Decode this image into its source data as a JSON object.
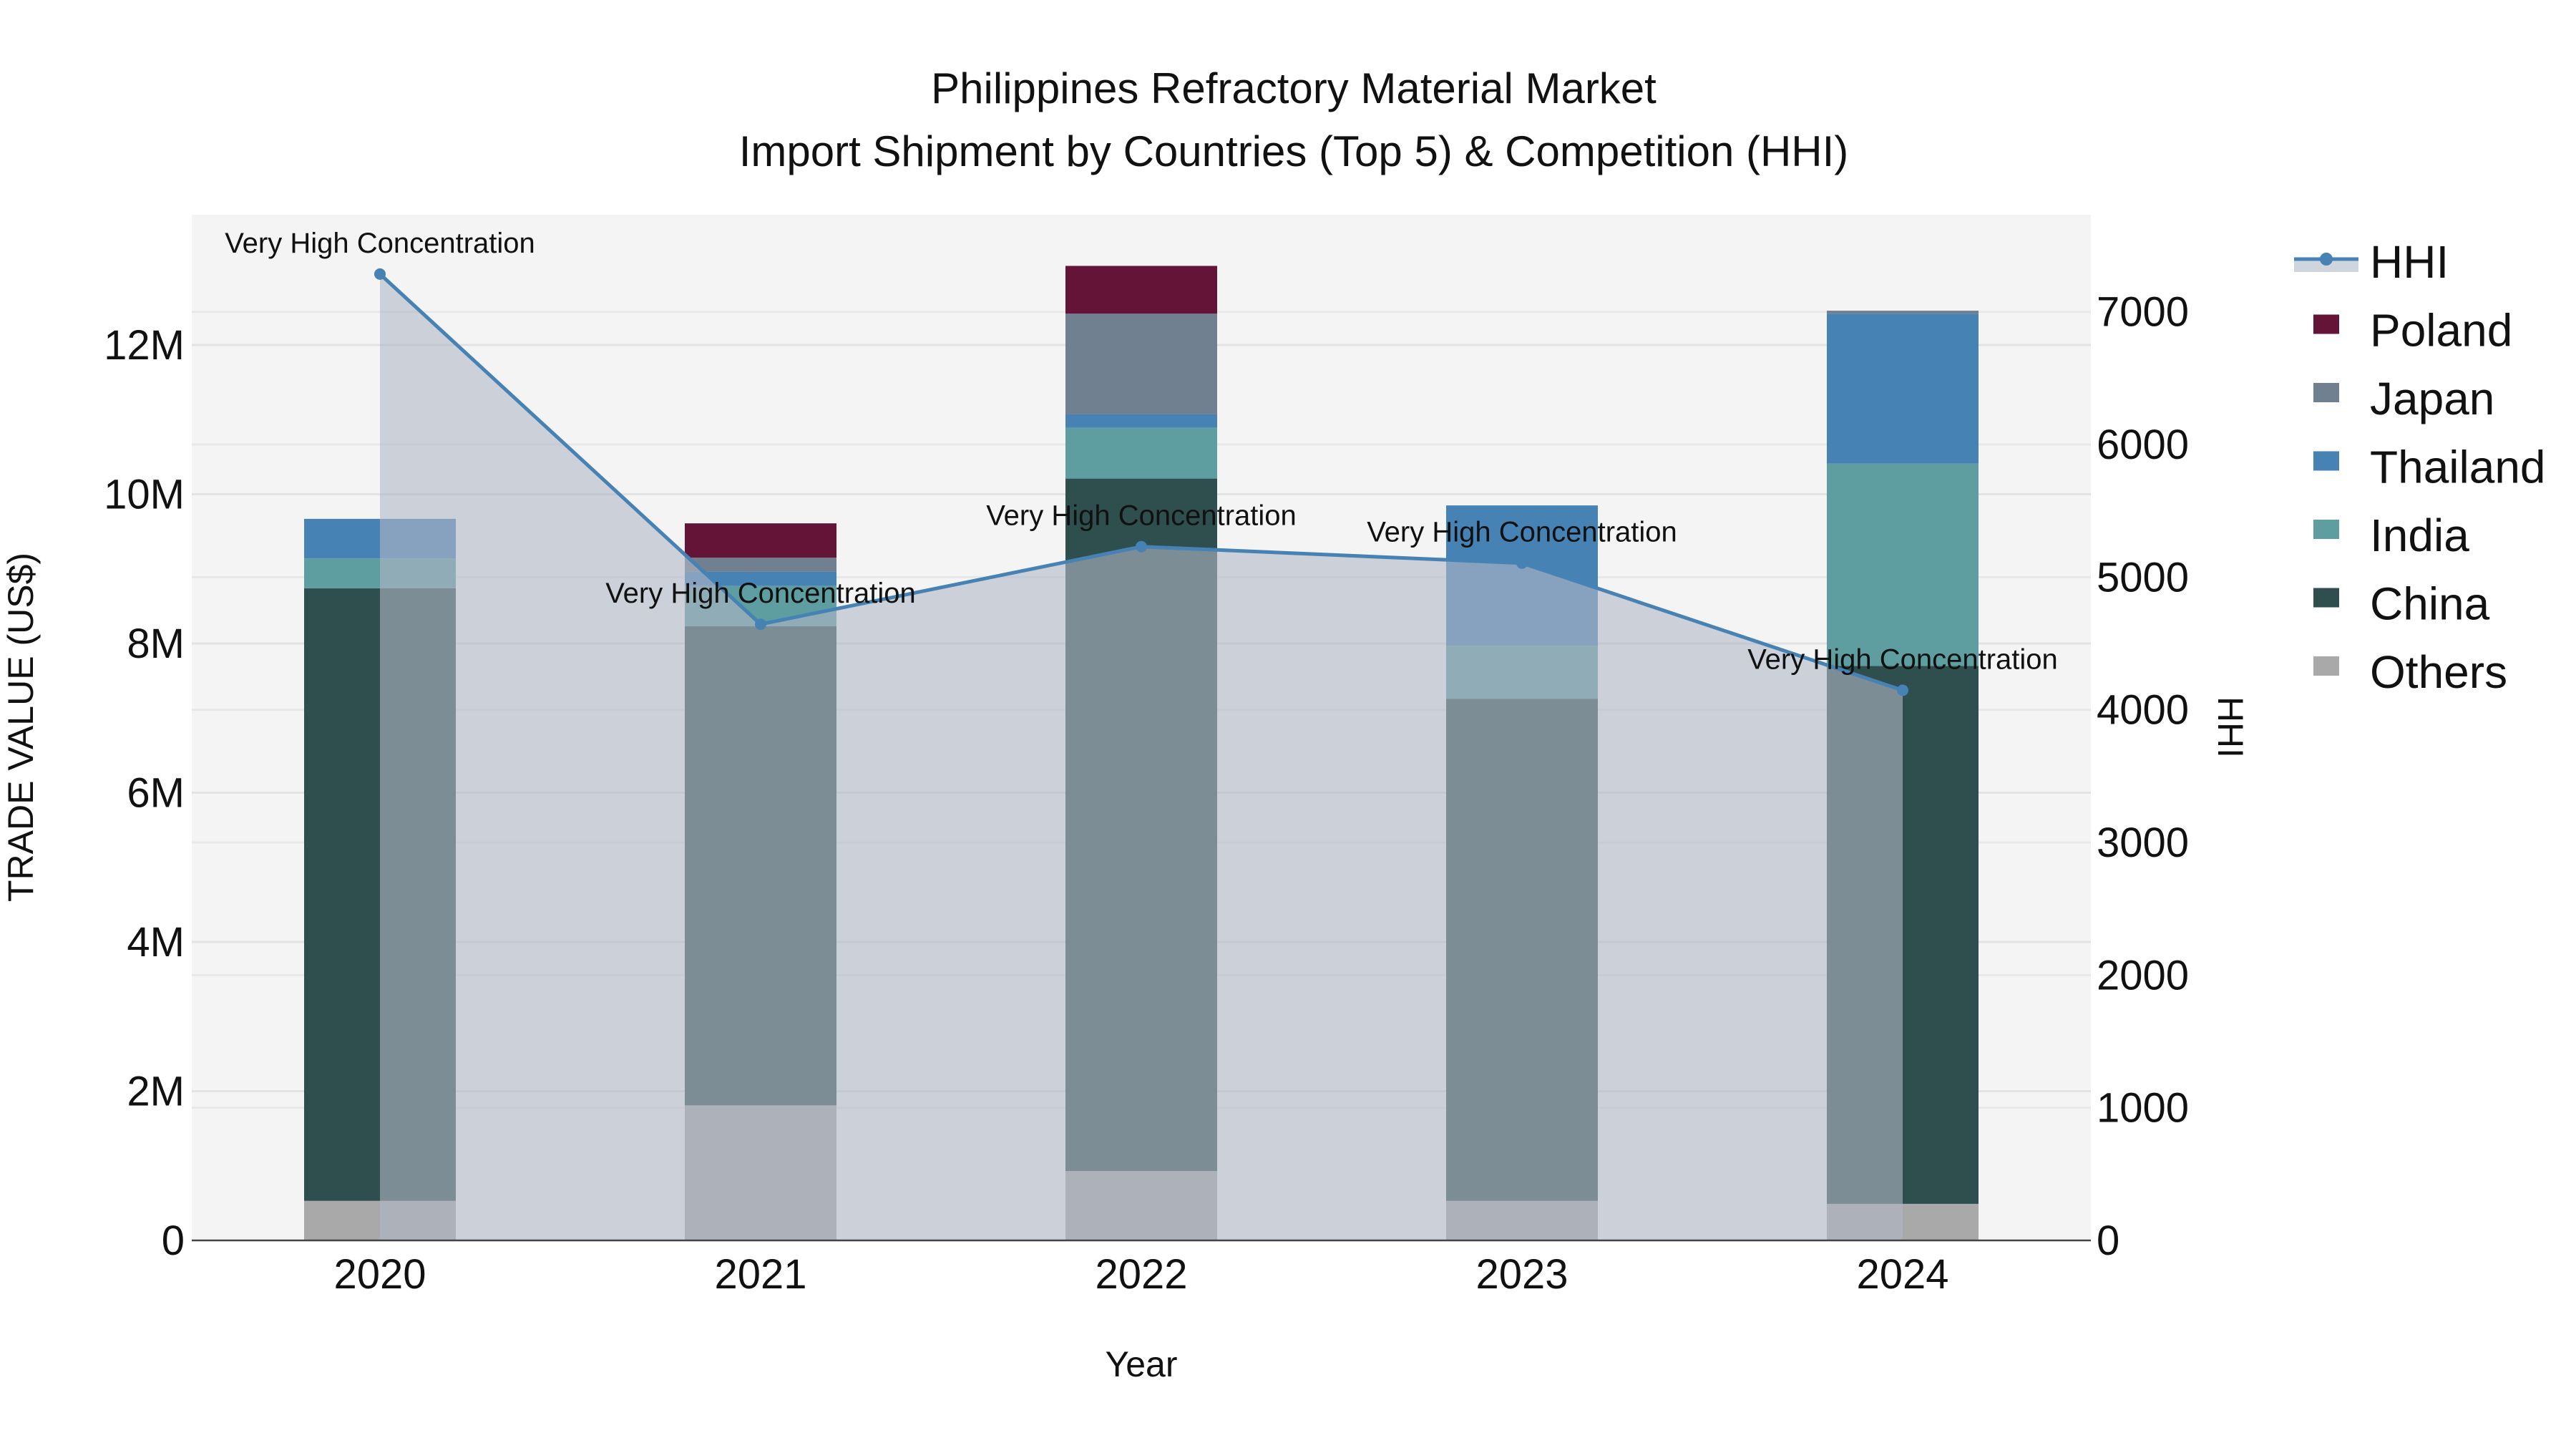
{
  "chart_data": {
    "type": "bar",
    "title_line1": "Philippines Refractory Material Market",
    "title_line2": "Import Shipment by Countries (Top 5) & Competition (HHI)",
    "xlabel": "Year",
    "ylabel": "TRADE VALUE (US$)",
    "y2label": "HHI",
    "categories": [
      "2020",
      "2021",
      "2022",
      "2023",
      "2024"
    ],
    "ylim": [
      0,
      13.7
    ],
    "y_unit": "M US$",
    "y_ticks": [
      0,
      2,
      4,
      6,
      8,
      10,
      12
    ],
    "y_tick_labels": [
      "0",
      "2M",
      "4M",
      "6M",
      "8M",
      "10M",
      "12M"
    ],
    "y2lim": [
      0,
      7700
    ],
    "y2_ticks": [
      0,
      1000,
      2000,
      3000,
      4000,
      5000,
      6000,
      7000
    ],
    "y2_tick_labels": [
      "0",
      "1000",
      "2000",
      "3000",
      "4000",
      "5000",
      "6000",
      "7000"
    ],
    "series": [
      {
        "name": "Others",
        "color": "#a9a9a9",
        "values": [
          0.53,
          1.81,
          0.93,
          0.53,
          0.49
        ]
      },
      {
        "name": "China",
        "color": "#2f4f4f",
        "values": [
          8.21,
          6.42,
          9.28,
          6.73,
          7.21
        ]
      },
      {
        "name": "India",
        "color": "#5f9ea0",
        "values": [
          0.4,
          0.54,
          0.68,
          0.71,
          2.71
        ]
      },
      {
        "name": "Thailand",
        "color": "#4682b4",
        "values": [
          0.53,
          0.19,
          0.18,
          1.88,
          2.01
        ]
      },
      {
        "name": "Japan",
        "color": "#708090",
        "values": [
          0,
          0.19,
          1.35,
          0,
          0.04
        ]
      },
      {
        "name": "Poland",
        "color": "#641436",
        "values": [
          0,
          0.46,
          0.64,
          0,
          0
        ]
      }
    ],
    "hhi": {
      "name": "HHI",
      "color": "#4682b4",
      "values": [
        7285,
        4645,
        5230,
        5106,
        4147
      ],
      "annotations": [
        "Very High Concentration",
        "Very High Concentration",
        "Very High Concentration",
        "Very High Concentration",
        "Very High Concentration"
      ]
    },
    "legend": [
      "HHI",
      "Poland",
      "Japan",
      "Thailand",
      "India",
      "China",
      "Others"
    ],
    "legend_placement": "right",
    "grid": true
  }
}
